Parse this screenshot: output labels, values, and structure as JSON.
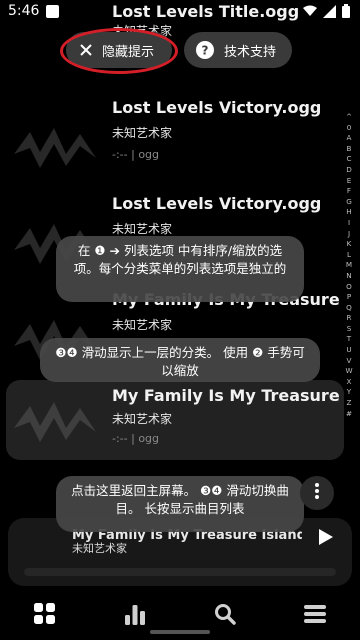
{
  "status": {
    "time": "5:46"
  },
  "tracks": [
    {
      "title": "Lost Levels Title.ogg",
      "artist": "未知艺术家",
      "meta": ""
    },
    {
      "title": "Lost Levels Victory.ogg",
      "artist": "未知艺术家",
      "meta": "-:-- | ogg"
    },
    {
      "title": "Lost Levels Victory.ogg",
      "artist": "未知艺术家",
      "meta": ""
    },
    {
      "title": "My Family Is My Treasure Is...",
      "artist": "未知艺术家",
      "meta": ""
    },
    {
      "title": "My Family Is My Treasure Is...",
      "artist": "未知艺术家",
      "meta": "-:-- | ogg"
    }
  ],
  "index_letters": [
    "^",
    "0",
    "A",
    "B",
    "C",
    "D",
    "E",
    "F",
    "G",
    "H",
    "I",
    "J",
    "K",
    "L",
    "M",
    "N",
    "O",
    "P",
    "Q",
    "R",
    "S",
    "T",
    "U",
    "V",
    "W",
    "X",
    "Y",
    "Z",
    "#"
  ],
  "top_buttons": {
    "hide_tips": "隐藏提示",
    "support": "技术支持"
  },
  "tips": {
    "tip1": "在 ❶ ➔ 列表选项 中有排序/缩放的选项。每个分类菜单的列表选项是独立的",
    "tip2": "❸❹ 滑动显示上一层的分类。 使用 ❷ 手势可以缩放",
    "tip3": "点击这里返回主屏幕。 ❸❹ 滑动切换曲目。 长按显示曲目列表"
  },
  "mini_player": {
    "title": "My Family Is My Treasure Island.",
    "artist": "未知艺术家"
  },
  "colors": {
    "background": "#000000",
    "pill": "#3a3a3a",
    "tooltip": "#484848",
    "highlight_circle": "#d41f28"
  },
  "icons": [
    "close-icon",
    "help-icon",
    "more-vert-icon",
    "play-icon",
    "grid-icon",
    "bars-icon",
    "search-icon",
    "playlist-icon"
  ]
}
